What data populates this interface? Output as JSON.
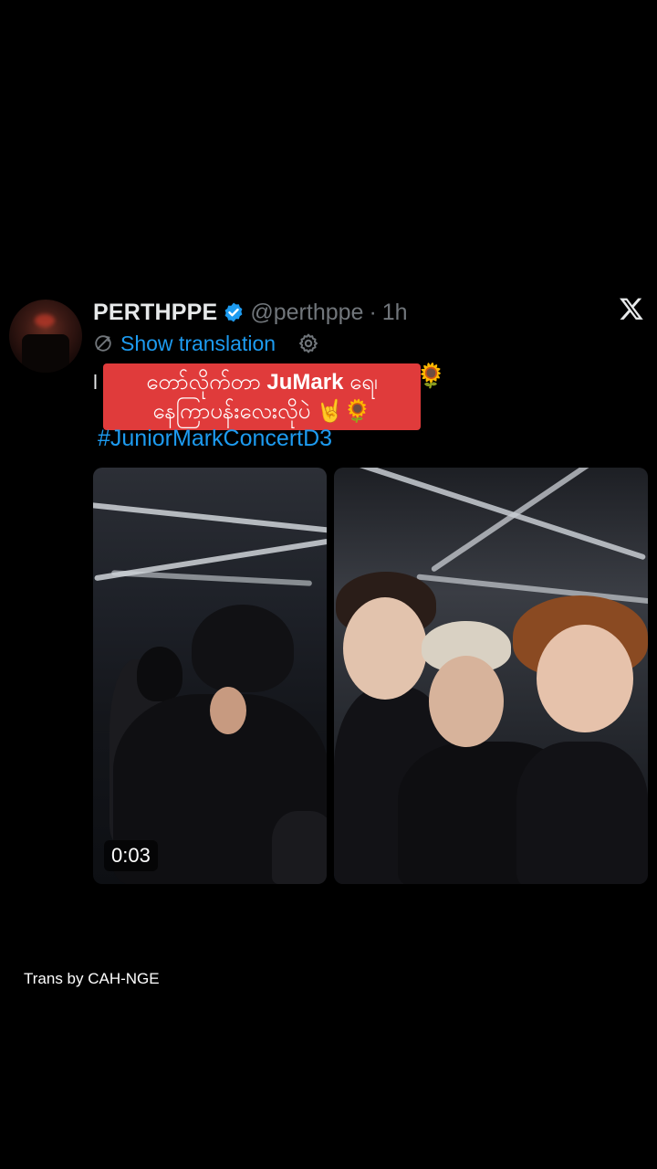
{
  "tweet": {
    "display_name": "PERTHPPE",
    "handle": "@perthppe",
    "separator": "·",
    "time": "1h",
    "show_translation": "Show translation",
    "text_prefix": "l",
    "hashtag": "#JuniorMarkConcertD3",
    "video_duration": "0:03",
    "overlay_line1_a": "တော်လိုက်တာ ",
    "overlay_line1_b": "JuMark",
    "overlay_line1_c": " ရေ၊",
    "overlay_line2": "နေကြာပန်းလေးလိုပဲ 🤘🌻",
    "emoji_trailing": "🌻"
  },
  "colors": {
    "background": "#000000",
    "link_blue": "#1d9bf0",
    "muted_gray": "#71767b",
    "overlay_red": "#e03b3b"
  },
  "icons": {
    "verified": "verified-badge-icon",
    "x_logo": "x-logo-icon",
    "translate": "translate-icon",
    "settings": "gear-icon"
  },
  "footer": {
    "credit": "Trans by CAH-NGE"
  }
}
